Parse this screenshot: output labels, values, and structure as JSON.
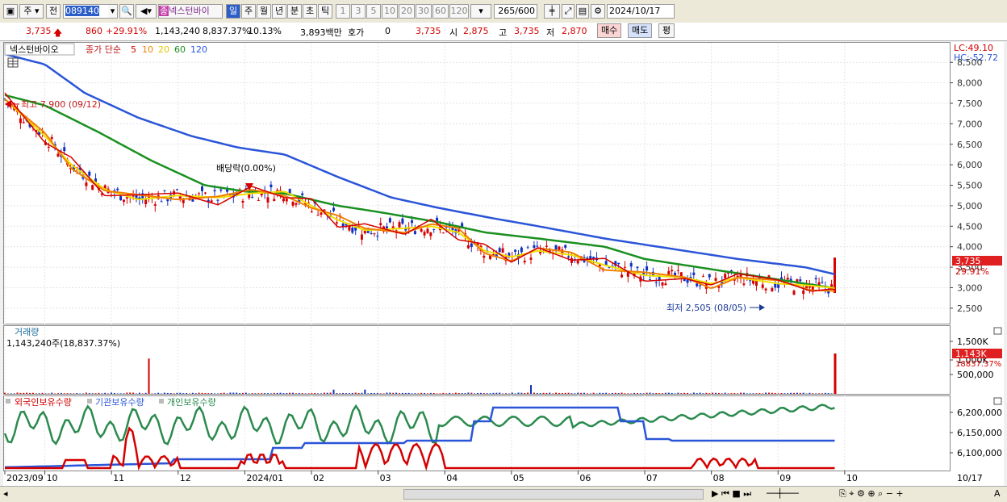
{
  "toolbar": {
    "market": "주",
    "prefix": "전",
    "code": "089140",
    "type_badge": "종",
    "name": "넥스턴바이",
    "periods": [
      "일",
      "주",
      "월",
      "년",
      "분",
      "초",
      "틱"
    ],
    "active_period": "일",
    "intervals": [
      "1",
      "3",
      "5",
      "10",
      "20",
      "30",
      "60",
      "120"
    ],
    "count": "265",
    "count_total": "/600",
    "date": "2024/10/17"
  },
  "quote": {
    "price": "3,735",
    "change": "860",
    "change_pct": "+29.91%",
    "volume": "1,143,240",
    "vol_pct": "8,837.37%",
    "turnover": "10.13%",
    "amount": "3,893백만",
    "hoga_label": "호가",
    "hoga_value": "0",
    "hoga_price": "3,735",
    "open_label": "시",
    "open": "2,875",
    "high_label": "고",
    "high": "3,735",
    "low_label": "저",
    "low": "2,870",
    "buy": "매수",
    "sell": "매도",
    "eval": "평"
  },
  "price_pane": {
    "name": "넥스턴바이오",
    "ma_title": "종가 단순",
    "ma_periods": [
      "5",
      "10",
      "20",
      "60",
      "120"
    ],
    "ma_colors": [
      "#d40000",
      "#f08000",
      "#f0e000",
      "#1a9020",
      "#2a55d8"
    ],
    "lc": "LC:49.10",
    "hc": "HC:-52.72",
    "y_ticks": [
      "8,500",
      "8,000",
      "7,500",
      "7,000",
      "6,500",
      "6,000",
      "5,500",
      "5,000",
      "4,500",
      "4,000",
      "3,500",
      "3,000",
      "2,500"
    ],
    "high_note": "최고 7,900 (09/12)",
    "dividend_note": "배당락(0.00%)",
    "low_note": "최저 2,505 (08/05)",
    "last_price": "3,735",
    "last_pct": "29.91%"
  },
  "volume_pane": {
    "title": "거래량",
    "info": "1,143,240주(18,837.37%)",
    "y_ticks": [
      "1,500K",
      "1,000K",
      "500,000"
    ],
    "last_vol": "1,143K",
    "last_pct": "18837.37%"
  },
  "holdings_pane": {
    "foreign": "외국인보유수량",
    "inst": "기관보유수량",
    "retail": "개인보유수량",
    "y_ticks": [
      "6,200,000",
      "6,150,000",
      "6,100,000"
    ]
  },
  "x_axis": [
    "2023/09",
    "10",
    "11",
    "12",
    "2024/01",
    "02",
    "03",
    "04",
    "05",
    "06",
    "07",
    "08",
    "09",
    "10"
  ],
  "x_right": "10/17",
  "chart_data": {
    "type": "candlestick",
    "price_ylim": [
      2300,
      8800
    ],
    "series": [
      {
        "name": "120",
        "keypoints_month_price": [
          [
            0,
            8700
          ],
          [
            2,
            7400
          ],
          [
            4,
            6400
          ],
          [
            6,
            5200
          ],
          [
            8,
            4300
          ],
          [
            10,
            3700
          ],
          [
            12,
            3250
          ]
        ]
      },
      {
        "name": "60",
        "keypoints_month_price": [
          [
            0,
            7700
          ],
          [
            2,
            6500
          ],
          [
            4,
            5350
          ],
          [
            6,
            4700
          ],
          [
            8,
            4000
          ],
          [
            10,
            3250
          ],
          [
            12,
            3050
          ]
        ]
      }
    ],
    "high": {
      "value": 7900,
      "date": "09/12"
    },
    "low": {
      "value": 2505,
      "date": "08/05"
    },
    "last": {
      "value": 3735,
      "pct": 29.91
    },
    "last_volume": 1143240
  }
}
